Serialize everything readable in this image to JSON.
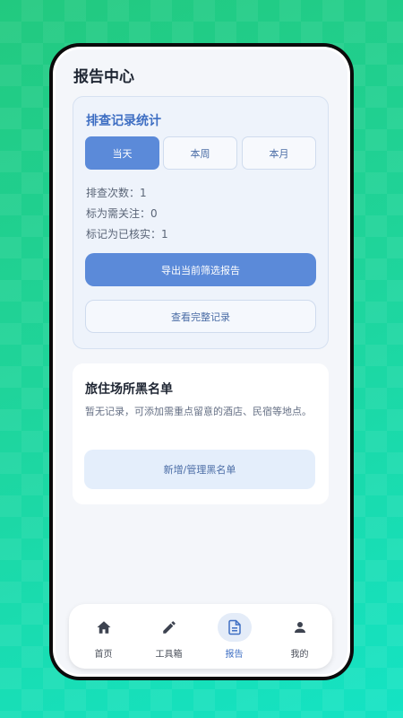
{
  "page": {
    "title": "报告中心"
  },
  "stats": {
    "title": "排查记录统计",
    "periods": [
      "当天",
      "本周",
      "本月"
    ],
    "active_period": "当天",
    "lines": [
      "排查次数：1",
      "标为需关注：0",
      "标记为已核实：1"
    ],
    "export_label": "导出当前筛选报告",
    "view_all_label": "查看完整记录"
  },
  "blacklist": {
    "title": "旅住场所黑名单",
    "description": "暂无记录，可添加需重点留意的酒店、民宿等地点。",
    "manage_label": "新增/管理黑名单"
  },
  "tabbar": {
    "items": [
      {
        "label": "首页",
        "icon": "home-icon"
      },
      {
        "label": "工具箱",
        "icon": "pencil-icon"
      },
      {
        "label": "报告",
        "icon": "document-icon"
      },
      {
        "label": "我的",
        "icon": "person-icon"
      }
    ],
    "active": "报告"
  },
  "colors": {
    "accent": "#5b8ad9",
    "background_gradient_start": "#22c97f",
    "background_gradient_end": "#14e3c4"
  }
}
